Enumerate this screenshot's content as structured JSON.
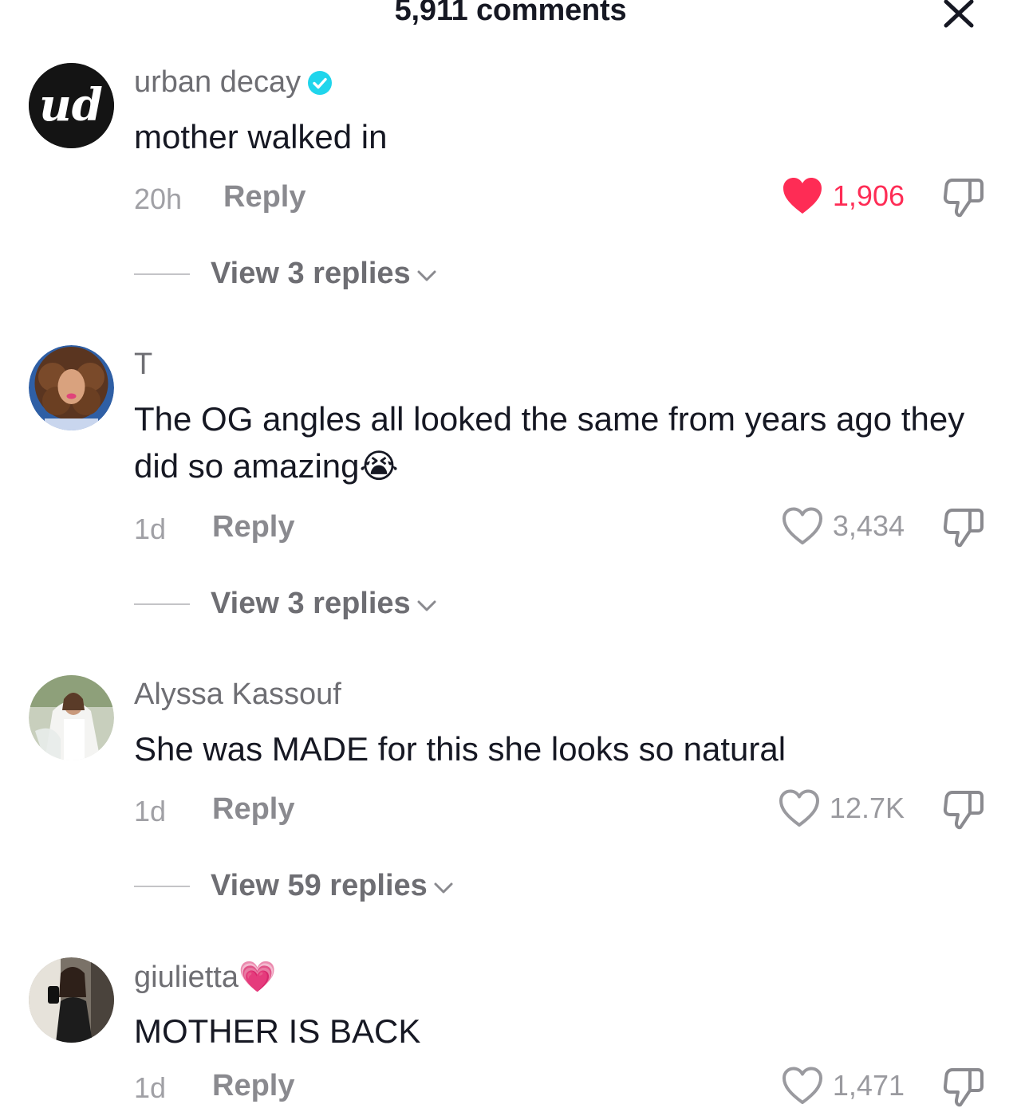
{
  "header": {
    "title": "5,911 comments"
  },
  "comments": [
    {
      "username": "urban decay",
      "verified": true,
      "avatar_text": "ud",
      "text": "mother walked in",
      "time": "20h",
      "reply_label": "Reply",
      "likes": "1,906",
      "liked": true,
      "view_replies": "View 3 replies"
    },
    {
      "username": "T",
      "verified": false,
      "text": "The OG angles all looked the same from years ago they did so amazing😭",
      "time": "1d",
      "reply_label": "Reply",
      "likes": "3,434",
      "liked": false,
      "view_replies": "View 3 replies"
    },
    {
      "username": "Alyssa Kassouf",
      "verified": false,
      "text": "She was MADE for this she looks so natural",
      "time": "1d",
      "reply_label": "Reply",
      "likes": "12.7K",
      "liked": false,
      "view_replies": "View 59 replies"
    },
    {
      "username": "giulietta💗",
      "verified": false,
      "text": "MOTHER IS BACK",
      "time": "1d",
      "reply_label": "Reply",
      "likes": "1,471",
      "liked": false
    }
  ],
  "colors": {
    "liked": "#fe2c55",
    "verified": "#20d5ec",
    "text": "#161823",
    "secondary": "#6e6e73"
  }
}
